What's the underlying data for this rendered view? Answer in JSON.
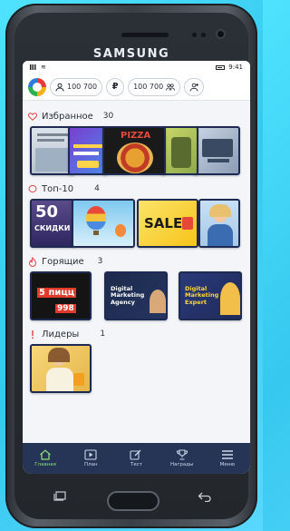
{
  "device": {
    "brand": "SAMSUNG"
  },
  "status": {
    "time": "9:41"
  },
  "topbar": {
    "coins": "100 700",
    "rubles": "100 700",
    "ruble_symbol": "₽"
  },
  "sections": [
    {
      "label": "Избранное",
      "count": "30"
    },
    {
      "label": "Топ-10",
      "count": "4"
    },
    {
      "label": "Горящие",
      "count": "3"
    },
    {
      "label": "Лидеры",
      "count": "1"
    }
  ],
  "thumbs": {
    "pizza": "PIZZA",
    "fifty": "50",
    "discount": "СКИДКИ",
    "sale": "SALE",
    "five_pizzas": "5 пицц",
    "price": "998",
    "digital_agency_1": "Digital Marketing Agency",
    "digital_agency_2": "Digital Marketing Expert"
  },
  "nav": [
    {
      "label": "Главная"
    },
    {
      "label": "План"
    },
    {
      "label": "Тест"
    },
    {
      "label": "Награды"
    },
    {
      "label": "Меню"
    }
  ],
  "colors": {
    "accent_nav": "#263455",
    "active_nav": "#8ee07a",
    "heart": "#e04545",
    "thumb_border": "#1e2a52"
  }
}
